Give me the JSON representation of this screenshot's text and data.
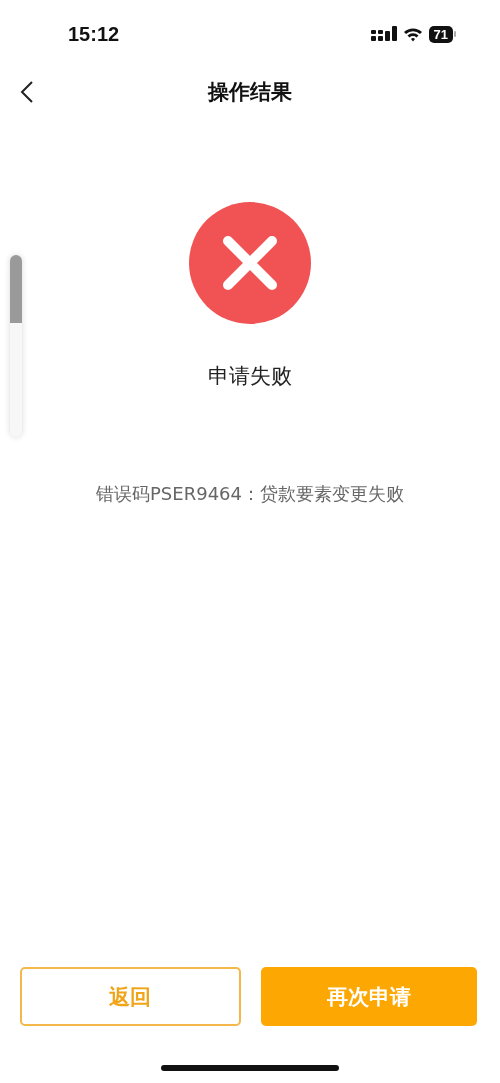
{
  "status_bar": {
    "time": "15:12",
    "battery": "71"
  },
  "nav": {
    "title": "操作结果"
  },
  "result": {
    "failed": true,
    "title": "申请失败",
    "message": "错误码PSER9464：贷款要素变更失败"
  },
  "buttons": [
    {
      "label": "返回",
      "kind": "outline"
    },
    {
      "label": "再次申请",
      "kind": "primary"
    }
  ]
}
